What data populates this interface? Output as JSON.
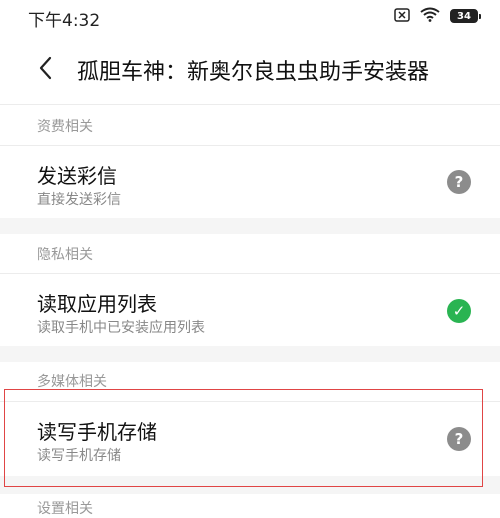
{
  "status_bar": {
    "time": "下午4:32",
    "battery": "34",
    "icons": [
      "sim-x-icon",
      "wifi-icon",
      "battery-icon"
    ]
  },
  "header": {
    "title": "孤胆车神：新奥尔良虫虫助手安装器",
    "back_icon": "chevron-left-icon"
  },
  "sections": [
    {
      "header": "资费相关",
      "items": [
        {
          "title": "发送彩信",
          "desc": "直接发送彩信",
          "status": "unknown",
          "status_glyph": "?"
        }
      ]
    },
    {
      "header": "隐私相关",
      "items": [
        {
          "title": "读取应用列表",
          "desc": "读取手机中已安装应用列表",
          "status": "granted",
          "status_glyph": "✓"
        }
      ]
    },
    {
      "header": "多媒体相关",
      "items": [
        {
          "title": "读写手机存储",
          "desc": "读写手机存储",
          "status": "unknown",
          "status_glyph": "?"
        }
      ]
    },
    {
      "header": "设置相关",
      "items": []
    }
  ],
  "colors": {
    "granted": "#2ab452",
    "unknown": "#8c8c8c",
    "highlight": "#e04545"
  }
}
